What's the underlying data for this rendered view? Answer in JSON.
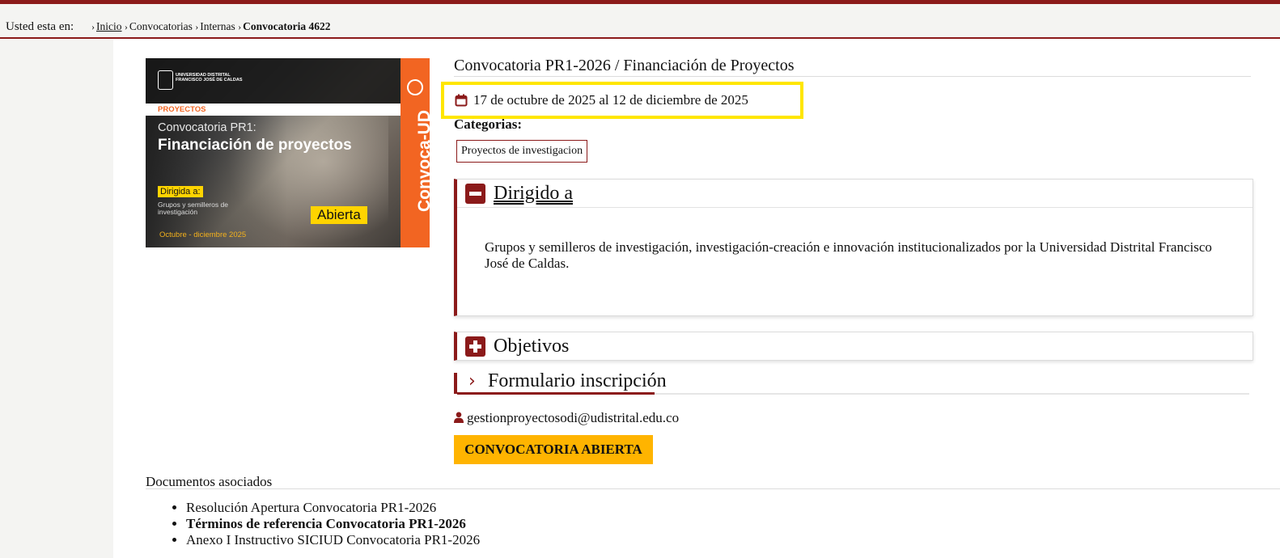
{
  "breadcrumb": {
    "prefix": "Usted esta en:",
    "items": [
      "Inicio",
      "Convocatorias",
      "Internas",
      "Convocatoria 4622"
    ],
    "separator": "›"
  },
  "banner": {
    "university": "UNIVERSIDAD DISTRITAL FRANCISCO JOSÉ DE CALDAS",
    "section": "PROYECTOS",
    "line1": "Convocatoria PR1:",
    "line2": "Financiación de proyectos",
    "dirigida": "Dirigida a:",
    "grupos": "Grupos y semilleros de investigación",
    "status": "Abierta",
    "period": "Octubre - diciembre 2025",
    "brand": "Convoca-UD"
  },
  "convocatoria": {
    "title": "Convocatoria PR1-2026 / Financiación de Proyectos",
    "dates": "17 de octubre de 2025 al 12 de diciembre de 2025",
    "categories_label": "Categorias:",
    "categories": [
      "Proyectos de investigacion"
    ]
  },
  "panels": {
    "dirigido": {
      "title": "Dirigido a",
      "body": "Grupos y semilleros de investigación, investigación-creación e innovación institucionalizados por la Universidad Distrital Francisco José de Caldas.",
      "expanded": true
    },
    "objetivos": {
      "title": "Objetivos",
      "expanded": false
    }
  },
  "form_link": {
    "label": "Formulario inscripción"
  },
  "contact": {
    "email": "gestionproyectosodi@udistrital.edu.co"
  },
  "status_button": {
    "label": "CONVOCATORIA ABIERTA"
  },
  "documents": {
    "title": "Documentos asociados",
    "items": [
      {
        "label": "Resolución Apertura Convocatoria PR1-2026",
        "bold": false
      },
      {
        "label": "Términos de referencia Convocatoria PR1-2026",
        "bold": true
      },
      {
        "label": "Anexo I Instructivo SICIUD Convocatoria PR1-2026",
        "bold": false
      }
    ]
  },
  "colors": {
    "accent": "#8b1a1a",
    "highlight": "#ffe600",
    "status": "#ffb400",
    "banner_orange": "#f26522"
  }
}
